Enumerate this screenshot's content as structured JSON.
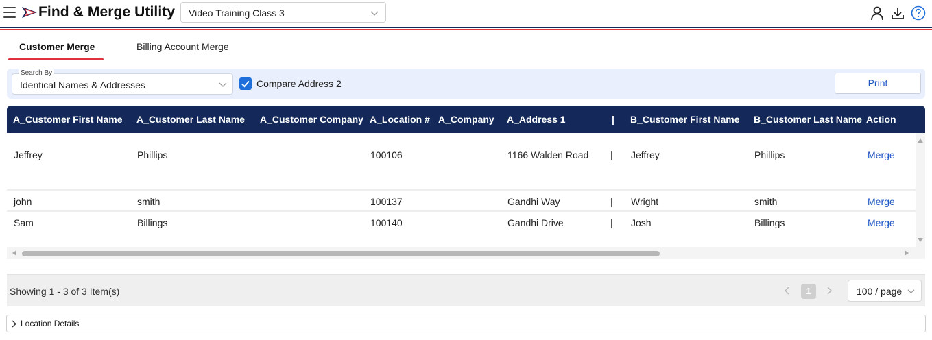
{
  "header": {
    "title": "Find & Merge Utility",
    "class_select": {
      "value": "Video Training Class 3"
    },
    "icons": [
      "menu-icon",
      "logo-flag",
      "user-icon",
      "download-icon",
      "help-icon"
    ]
  },
  "tabs": [
    {
      "label": "Customer Merge",
      "active": true
    },
    {
      "label": "Billing Account Merge",
      "active": false
    }
  ],
  "filters": {
    "search_by_label": "Search By",
    "search_by_value": "Identical Names & Addresses",
    "compare_address2_label": "Compare Address 2",
    "compare_address2_checked": true,
    "print_label": "Print"
  },
  "table": {
    "columns": [
      "A_Customer First Name",
      "A_Customer Last Name",
      "A_Customer Company",
      "A_Location #",
      "A_Company",
      "A_Address 1",
      "|",
      "B_Customer First Name",
      "B_Customer Last Name",
      "Action"
    ],
    "rows": [
      {
        "a_first": "Jeffrey",
        "a_last": "Phillips",
        "a_company": "",
        "a_location": "100106",
        "a_comp": "",
        "a_address": "1166 Walden Road",
        "sep": "|",
        "b_first": "Jeffrey",
        "b_last": "Phillips",
        "action": "Merge"
      },
      {
        "a_first": "john",
        "a_last": "smith",
        "a_company": "",
        "a_location": "100137",
        "a_comp": "",
        "a_address": "Gandhi Way",
        "sep": "|",
        "b_first": "Wright",
        "b_last": "smith",
        "action": "Merge"
      },
      {
        "a_first": "Sam",
        "a_last": "Billings",
        "a_company": "",
        "a_location": "100140",
        "a_comp": "",
        "a_address": "Gandhi Drive",
        "sep": "|",
        "b_first": "Josh",
        "b_last": "Billings",
        "action": "Merge"
      }
    ]
  },
  "pagination": {
    "showing": "Showing 1 - 3 of 3 Item(s)",
    "current_page": "1",
    "per_page": "100 / page"
  },
  "location_details": {
    "label": "Location Details"
  },
  "colors": {
    "header_navy": "#14295a",
    "accent_red": "#e0313d",
    "link_blue": "#1e56c4",
    "checkbox_blue": "#1e6fd9",
    "filter_bg": "#e9effc"
  }
}
